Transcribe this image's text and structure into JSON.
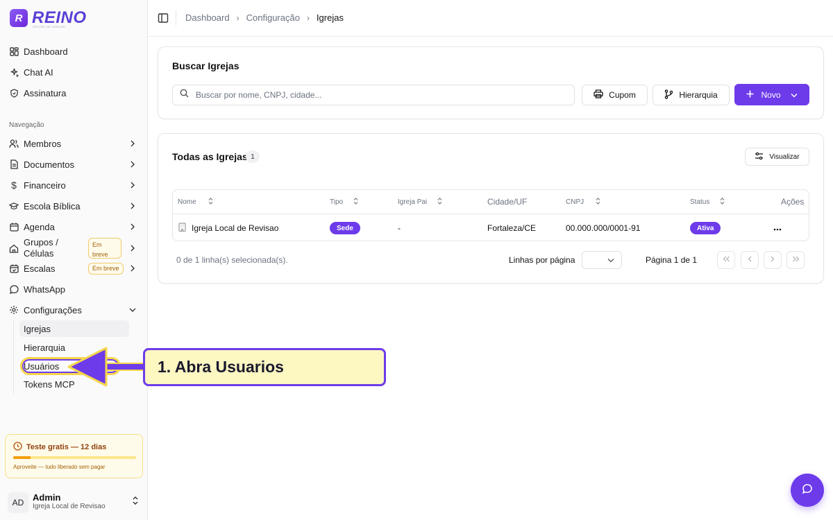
{
  "brand": {
    "name": "REINO",
    "tagline": "GESTÃO DE IGREJAS",
    "mark": "R"
  },
  "sidebar": {
    "top_items": [
      {
        "label": "Dashboard",
        "icon": "grid-icon"
      },
      {
        "label": "Chat AI",
        "icon": "sparkles-icon"
      },
      {
        "label": "Assinatura",
        "icon": "shield-icon"
      }
    ],
    "section_label": "Navegação",
    "nav_items": [
      {
        "label": "Membros",
        "icon": "users-icon"
      },
      {
        "label": "Documentos",
        "icon": "file-icon"
      },
      {
        "label": "Financeiro",
        "icon": "dollar-icon"
      },
      {
        "label": "Escola Bíblica",
        "icon": "graduation-cap-icon"
      },
      {
        "label": "Agenda",
        "icon": "calendar-icon"
      },
      {
        "label": "Grupos / Células",
        "icon": "home-icon",
        "badge": "Em breve"
      },
      {
        "label": "Escalas",
        "icon": "calendar-check-icon",
        "badge": "Em breve"
      },
      {
        "label": "WhatsApp",
        "icon": "message-circle-icon"
      },
      {
        "label": "Configurações",
        "icon": "gear-icon"
      }
    ],
    "sub_items": [
      {
        "label": "Igrejas"
      },
      {
        "label": "Hierarquia"
      },
      {
        "label": "Usuários"
      },
      {
        "label": "Tokens MCP"
      }
    ],
    "trial": {
      "title": "Teste gratis — 12 dias",
      "note": "Aproveite — tudo liberado sem pagar",
      "progress": 0.14
    },
    "user": {
      "initials": "AD",
      "name": "Admin",
      "org": "Igreja Local de Revisao"
    }
  },
  "breadcrumb": [
    "Dashboard",
    "Configuração",
    "Igrejas"
  ],
  "search_card": {
    "title": "Buscar Igrejas",
    "placeholder": "Buscar por nome, CNPJ, cidade...",
    "buttons": {
      "cupom": "Cupom",
      "hierarquia": "Hierarquia",
      "novo": "Novo"
    }
  },
  "table_card": {
    "title": "Todas as Igrejas",
    "count": "1",
    "view_button": "Visualizar",
    "columns": [
      "Nome",
      "Tipo",
      "Igreja Pai",
      "Cidade/UF",
      "CNPJ",
      "Status",
      "Ações"
    ],
    "rows": [
      {
        "nome": "Igreja Local de Revisao",
        "tipo": "Sede",
        "igreja_pai": "-",
        "cidade": "Fortaleza/CE",
        "cnpj": "00.000.000/0001-91",
        "status": "Ativa"
      }
    ],
    "selection_text": "0 de 1 linha(s) selecionada(s).",
    "rows_per_page_label": "Linhas por página",
    "page_label": "Página 1 de 1"
  },
  "annotation": {
    "text": "1. Abra Usuarios"
  },
  "colors": {
    "accent": "#6d3bea",
    "highlight": "#f5d64b",
    "callout_bg": "#fdf7c2"
  }
}
